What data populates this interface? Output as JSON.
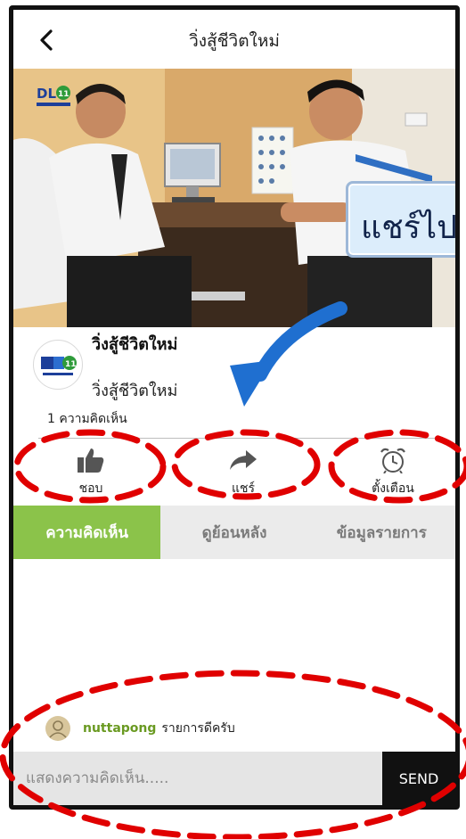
{
  "header": {
    "title": "วิ่งสู้ชีวิตใหม่"
  },
  "video": {
    "channel_logo_text": "DLTV 11",
    "callout_text": "แชร์ไปยั"
  },
  "program": {
    "logo_text": "DLTV 11",
    "logo_caption": "บุญมาศึกษาอีกาะ",
    "name": "วิ่งสู้ชีวิตใหม่",
    "subtitle": "วิ่งสู้ชีวิตใหม่",
    "comment_count": "1 ความคิดเห็น"
  },
  "actions": {
    "like": {
      "label": "ชอบ",
      "icon": "thumbs-up-icon"
    },
    "share": {
      "label": "แชร์",
      "icon": "share-arrow-icon"
    },
    "reminder": {
      "label": "ตั้งเตือน",
      "icon": "alarm-clock-icon"
    }
  },
  "tabs": [
    {
      "label": "ความคิดเห็น",
      "active": true
    },
    {
      "label": "ดูย้อนหลัง",
      "active": false
    },
    {
      "label": "ข้อมูลรายการ",
      "active": false
    }
  ],
  "comments": [
    {
      "user": "nuttapong",
      "text": "รายการดีครับ"
    }
  ],
  "composer": {
    "placeholder": "แสดงความคิดเห็น.....",
    "send_label": "SEND"
  },
  "colors": {
    "accent": "#8bc34a",
    "annotation": "#e00000",
    "arrow": "#1f6fd0",
    "send_bg": "#111111"
  }
}
